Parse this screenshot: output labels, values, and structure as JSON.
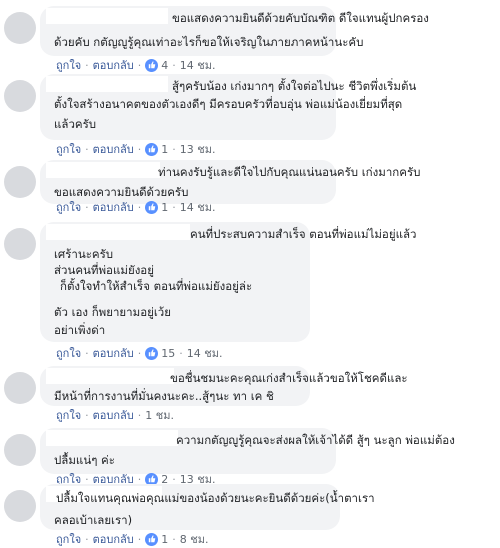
{
  "comments": [
    {
      "lines": [
        "ขอแสดงความยินดีด้วยคับบัณฑิต ดีใจแทนผู้ปกครอง",
        "ด้วยคับ กตัญญูรู้คุณเท่าอะไรก็ขอให้เจริญในภายภาคหน้านะคับ"
      ],
      "like_label": "ถูกใจ",
      "reply_label": "ตอบกลับ",
      "likes": "4",
      "time": "14 ชม."
    },
    {
      "lines": [
        "สู้ๆครับน้อง เก่งมากๆ ตั้งใจต่อไปนะ ชีวิตพึ่งเริ่มต้น",
        "ตั้งใจสร้างอนาคตของตัวเองดีๆ มีครอบครัวที่อบอุ่น พ่อแม่น้องเยี่ยมที่สุด",
        "แล้วครับ"
      ],
      "like_label": "ถูกใจ",
      "reply_label": "ตอบกลับ",
      "likes": "1",
      "time": "13 ชม."
    },
    {
      "lines": [
        "ท่านคงรับรู้และดีใจไปกับคุณแน่นอนครับ เก่งมากครับ",
        "ขอแสดงความยินดีด้วยครับ"
      ],
      "like_label": "ถูกใจ",
      "reply_label": "ตอบกลับ",
      "likes": "1",
      "time": "14 ชม."
    },
    {
      "lines": [
        "คนที่ประสบความสำเร็จ ตอนที่พ่อแม่ไม่อยู่แล้ว",
        "เศร้านะครับ",
        "ส่วนคนที่พ่อแม่ยังอยู่",
        "ก็ตั้งใจทำให้สำเร็จ ตอนที่พ่อแม่ยังอยู่ล่ะ",
        "ตัว  เอง ก็พยายามอยู่เว้ย",
        "อย่าเพิ่งด่า"
      ],
      "like_label": "ถูกใจ",
      "reply_label": "ตอบกลับ",
      "likes": "15",
      "time": "14 ชม."
    },
    {
      "lines": [
        "ขอชื่นชมนะคะคุณเก่งสำเร็จแล้วขอให้โชคดีและ",
        "มีหน้าที่การงานที่มั่นคงนะคะ..สู้ๆนะ ทา เค ชิ"
      ],
      "like_label": "ถูกใจ",
      "reply_label": "ตอบกลับ",
      "likes": "",
      "time": "1 ชม."
    },
    {
      "lines": [
        "ความกตัญญูรู้คุณจะส่งผลให้เจ้าได้ดี สู้ๆ นะลูก พ่อแม่ต้อง",
        "ปลื้มแน่ๆ ค่ะ"
      ],
      "like_label": "ถูกใจ",
      "reply_label": "ตอบกลับ",
      "likes": "2",
      "time": "13 ชม."
    },
    {
      "lines": [
        "ปลื้มใจแทนคุณพ่อคุณแม่ของน้องด้วยนะคะยินดีด้วยค่ะ(น้ำตาเรา",
        "คลอเบ้าเลยเรา)"
      ],
      "like_label": "ถูกใจ",
      "reply_label": "ตอบกลับ",
      "likes": "1",
      "time": "8 ชม."
    }
  ]
}
